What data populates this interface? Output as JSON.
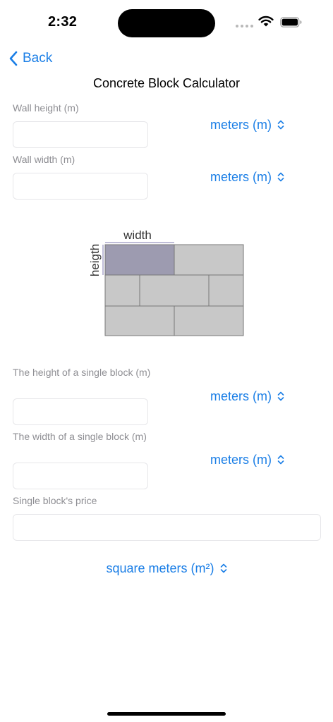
{
  "status": {
    "time": "2:32"
  },
  "nav": {
    "back_label": "Back",
    "title": "Concrete Block Calculator"
  },
  "fields": {
    "wall_height": {
      "label": "Wall height (m)",
      "value": "",
      "unit": "meters (m)"
    },
    "wall_width": {
      "label": "Wall width (m)",
      "value": "",
      "unit": "meters (m)"
    },
    "block_height": {
      "label": "The height of a single block (m)",
      "value": "",
      "unit": "meters (m)"
    },
    "block_width": {
      "label": "The width of a single block (m)",
      "value": "",
      "unit": "meters (m)"
    },
    "block_price": {
      "label": "Single block's price",
      "value": ""
    }
  },
  "diagram": {
    "width_label": "width",
    "height_label": "heigth"
  },
  "area_unit": "square meters (m²)",
  "colors": {
    "accent": "#1a7ee6",
    "label_gray": "#8e8e93",
    "block_fill": "#c8c8c8",
    "highlight_block": "#9d9bb0"
  }
}
